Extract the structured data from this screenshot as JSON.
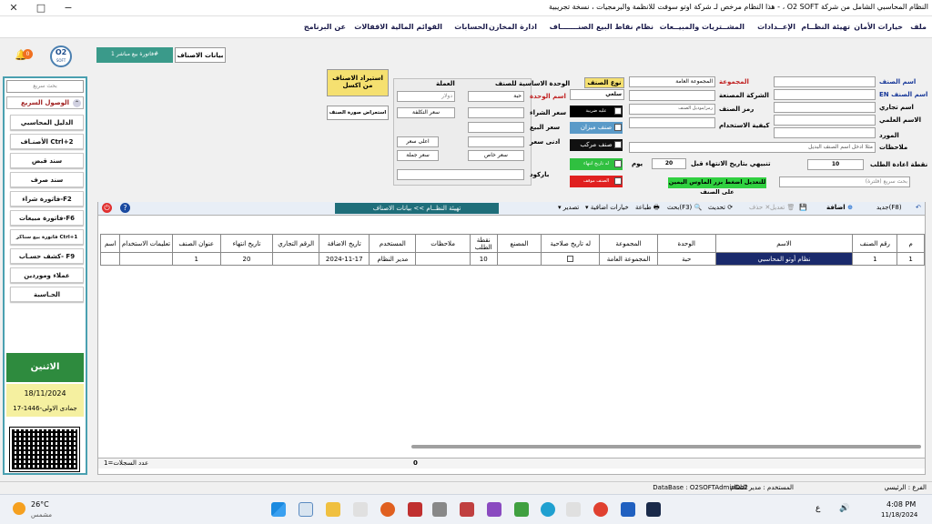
{
  "window": {
    "title": "النظام المحاسبي الشامل من شركة O2 SOFT ، - هذا النظام مرخص لـ شركة اوتو سوفت للانظمة والبرمجيات ، نسخة تجريبية",
    "minimize": "−",
    "maximize": "□",
    "close": "✕"
  },
  "menu": [
    "ملف",
    "خيارات الأمان",
    "تهيئة النظــام",
    "الإعــدادات",
    "المشــتريات والمبيــعات",
    "نظام نقاط البيع",
    "الصنـــــــاف",
    "ادارة المخازن",
    "الحسابات",
    "القوائم المالية",
    "الاقفالات",
    "عن البرنامج"
  ],
  "logo": {
    "top": "O2",
    "bottom": "SOFT"
  },
  "notification_count": "0",
  "sidebar": {
    "search_placeholder": "بحث سريع",
    "quick_access": "الوصول السريع",
    "buttons": [
      "الدليل المحاسبي",
      "الأصنـاف Ctrl+2",
      "سند قبض",
      "سند صرف",
      "فاتورة شراء-F2",
      "فاتورة مبيعات-F6",
      "فاتورة بيع سناكر Ctrl+1",
      "كشف حسـاب- F9",
      "عملاء وموردين",
      "الحـاسبة"
    ],
    "day": "الاثنين",
    "date": "18/11/2024",
    "hijri": "17-جمادى الاولى-1446"
  },
  "tabs": {
    "active": "بيانات الاصناف",
    "other": "فاتورة بيع مباشر 1#"
  },
  "form": {
    "import_button": "استيراد الاصناف من اكسل",
    "image_preview_button": "استعراض صورة الصنف",
    "currency_label": "العملة",
    "currency_value": "دولار",
    "cost_price_label": "سعر التكلفة",
    "highest_price_label": "اعلى سعر",
    "wholesale_price_label": "سعر جملة",
    "special_price_label": "سعر خاص",
    "base_unit_label": "الوحدة الاساسية للصنف",
    "unit_name_label": "اسم الوحدة",
    "unit_value": "حبة",
    "purchase_price_label": "سعر الشراء",
    "sale_price_label": "سعر البيع",
    "lowest_price_label": "ادنى سعر",
    "barcode_label": "باركود",
    "item_type_label": "نوع الصنف",
    "item_type_value": "سلعي",
    "tax_label": "عليه ضريبة",
    "scale_label": "صنف ميزان",
    "composite_label": "صنف مركب",
    "expiry_label": "له تاريخ انتهاء",
    "stopped_label": "الصنف موقف",
    "group_label": "المجموعة",
    "group_value": "المجموعة العامة",
    "manufacturer_label": "الشركة المصنعة",
    "item_code_label": "رمز الصنف",
    "usage_label": "كيفية الاستخدام",
    "item_code_hint": "رمز/موديل الصنف",
    "name_label": "اسم الصنف",
    "name_en_label": "اسم الصنف EN",
    "trade_name_label": "اسم تجاري",
    "scientific_name_label": "الاسم العلمي",
    "supplier_label": "المورد",
    "notes_label": "ملاحظات",
    "notes_placeholder": "مثلا ادخل اسم الصنف البديل",
    "expiry_warning_label": "تنبيهي بتاريخ الانتهاء قبل",
    "expiry_days": "20",
    "days_label": "يوم",
    "reorder_label": "نقطة اعادة الطلب",
    "reorder_value": "10",
    "edit_hint": "للتعديل اضغط بزر الماوس اليمين على الصنف",
    "filter_placeholder": "بحث سريع (فلترة)"
  },
  "breadcrumb": "تهيئة النظــام >> بيانات الاصناف",
  "toolbar": {
    "new": "جديد(F8)",
    "add": "اضافة",
    "edit": "تعديل",
    "delete": "حذف",
    "refresh": "تحديث",
    "search": "بحث(F3)",
    "print": "طباعة",
    "extra": "خيارات اضافية",
    "export": "تصدير"
  },
  "table": {
    "headers": [
      "م",
      "رقم الصنف",
      "الاسم",
      "الوحدة",
      "المجموعة",
      "له تاريخ صلاحية",
      "المصنع",
      "نقطة الطلب",
      "ملاحظات",
      "المستخدم",
      "تاريخ الاضافة",
      "الرقم التجاري",
      "تاريخ انتهاء",
      "عنوان الصنف",
      "تعليمات الاستخدام",
      "اسم"
    ],
    "rows": [
      [
        "1",
        "1",
        "نظام أوتو المحاسبي",
        "حبة",
        "المجموعة العامة",
        "",
        "",
        "10",
        "",
        "مدير النظام",
        "2024-11-17",
        "",
        "20",
        "1",
        "",
        ""
      ]
    ]
  },
  "record_count_label": "عدد السجلات=1",
  "record_count_value": "0",
  "status": {
    "branch": "الفرع : الرئيسي",
    "user": "المستخدم : مدير النظام",
    "database": "DataBase : O2SOFTAdminDb2"
  },
  "taskbar": {
    "weather_temp": "26°C",
    "weather_desc": "مشمس",
    "lang": "ع",
    "time": "4:08 PM",
    "date": "11/18/2024"
  },
  "colors": {
    "sidebar_border": "#4aa0b0",
    "day_bg": "#2e8b3e",
    "date_bg": "#f5f0a0",
    "breadcrumb_bg": "#1f6e7a",
    "selected_row": "#1a2a6c"
  }
}
